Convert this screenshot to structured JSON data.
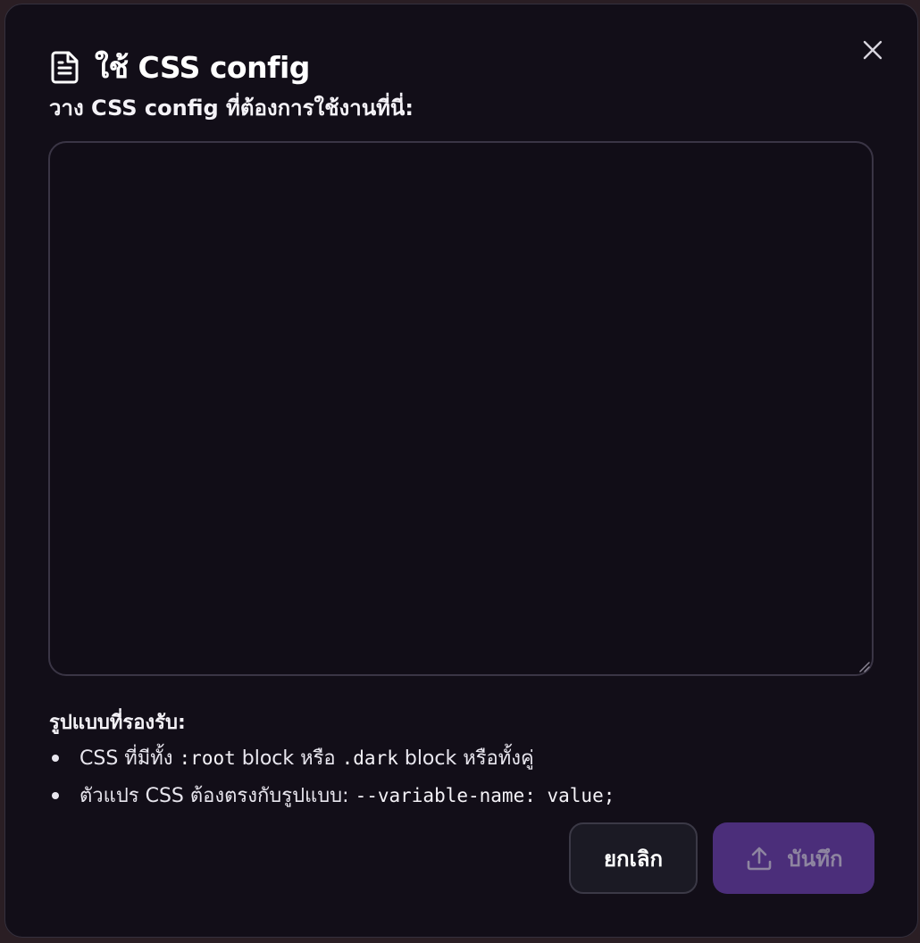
{
  "dialog": {
    "title": "ใช้ CSS config",
    "subtitle": "วาง CSS config ที่ต้องการใช้งานที่นี่:",
    "textarea": {
      "value": "",
      "placeholder": ""
    },
    "formats": {
      "heading": "รูปแบบที่รองรับ:",
      "item1": {
        "part1": "CSS ที่มีทั้ง ",
        "code1": ":root",
        "part2": " block หรือ ",
        "code2": ".dark",
        "part3": " block หรือทั้งคู่"
      },
      "item2": {
        "part1": "ตัวแปร CSS ต้องตรงกับรูปแบบ: ",
        "code1": "--variable-name: value;"
      }
    },
    "buttons": {
      "cancel_label": "ยกเลิก",
      "save_label": "บันทึก",
      "save_disabled": true
    },
    "icons": {
      "title_icon": "document-icon",
      "close_icon": "close-icon",
      "save_icon": "upload-icon"
    }
  },
  "colors": {
    "dialog_bg": "#120e18",
    "save_button_bg": "#4b2e7a",
    "cancel_button_bg": "#1b1a24"
  }
}
